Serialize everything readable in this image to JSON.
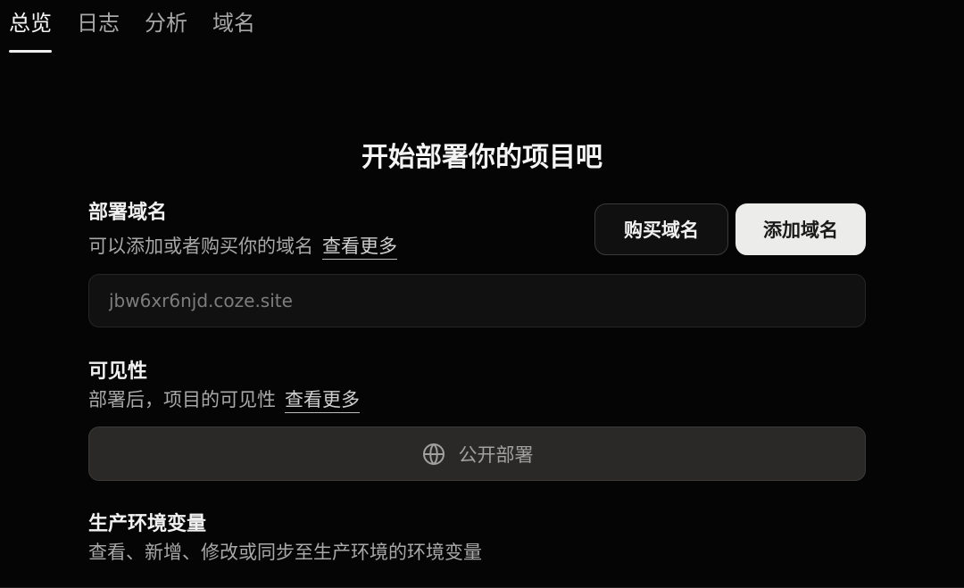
{
  "tabs": [
    {
      "label": "总览",
      "active": true
    },
    {
      "label": "日志"
    },
    {
      "label": "分析"
    },
    {
      "label": "域名"
    }
  ],
  "main": {
    "title": "开始部署你的项目吧"
  },
  "domain_section": {
    "title": "部署域名",
    "description": "可以添加或者购买你的域名",
    "more_link": "查看更多",
    "buy_button": "购买域名",
    "add_button": "添加域名",
    "domain_input": {
      "value": "",
      "placeholder": "jbw6xr6njd.coze.site"
    }
  },
  "visibility_section": {
    "title": "可见性",
    "description": "部署后，项目的可见性",
    "more_link": "查看更多",
    "option_icon": "globe-icon",
    "option_label": "公开部署"
  },
  "env_section": {
    "title": "生产环境变量",
    "description": "查看、新增、修改或同步至生产环境的环境变量"
  },
  "colors": {
    "background": "#050505",
    "text": "#f2f2f2",
    "muted_text": "#a8a8a8",
    "add_button": "#ececea"
  }
}
